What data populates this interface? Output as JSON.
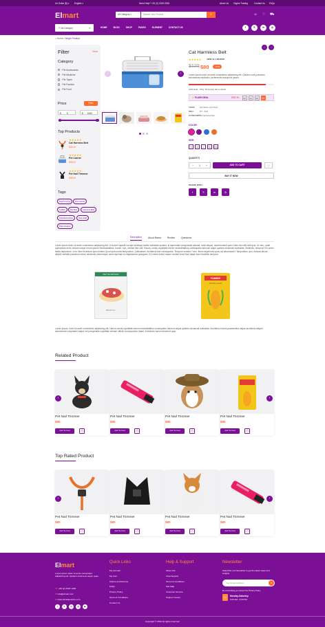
{
  "topbar": {
    "currency": "Us Dollar ($)",
    "language": "English",
    "help": "Need Help? +00 (2) 1525 2255",
    "links": [
      "About Us",
      "Orgine Trading",
      "Contact Us",
      "FAQs"
    ]
  },
  "header": {
    "logo_main": "El",
    "logo_accent": "mart",
    "category_select": "All Category",
    "search_placeholder": "Search Your Product",
    "all_category": "All Category",
    "nav": [
      "HOME",
      "BLOG",
      "SHOP",
      "PAGES",
      "ELEMENT",
      "CONTACT US"
    ],
    "socials": [
      "f",
      "𝕏",
      "in",
      "◎"
    ]
  },
  "breadcrumb": {
    "home": "Home",
    "sep": "/",
    "current": "Single Product"
  },
  "sidebar": {
    "filter_title": "Filter",
    "clear": "Clear",
    "category_title": "Category",
    "categories": [
      "Pet Accessories",
      "Pet Medicine",
      "Pet Toyes",
      "Pet Fashion",
      "Pet Food"
    ],
    "price_title": "Price",
    "filter_btn": "Filter",
    "price_min_currency": "$",
    "price_min": "5",
    "price_max_currency": "$",
    "price_max": "1000",
    "price_range": [
      0.05,
      1.0
    ],
    "top_products_title": "Top Products",
    "top_products": [
      {
        "name": "Cat Harness Belt",
        "price": "$35.00",
        "stars": "★★★★★"
      },
      {
        "name": "Pet Carrier",
        "price": "$35.00",
        "stars": "★★★★★"
      },
      {
        "name": "Pet Nail Trimmer",
        "price": "$35.00",
        "stars": "★★★★★"
      }
    ],
    "tags_title": "Tags",
    "tags": [
      "Nail Trimmer",
      "Pet Carrier",
      "Collars",
      "Pet Bed",
      "Harness Belt",
      "Checked cotton",
      "Sac scarf",
      "Paw Cleaner"
    ]
  },
  "product": {
    "title": "Cat Harmless Belt",
    "stars": "★★★★★",
    "reviews": "VIEW ALL REVIEW",
    "old_price": "$120",
    "price": "$80",
    "discount": "-10%",
    "description": "Lorem ipsum dolor sit amet consectetur adipisicing elit. Quidem sunt possimus accusamus explicabo, perferendis suscipit et ipsam.",
    "stock_text": "10% Sold - Only 15 Item(s) left in stock!",
    "stock_progress": 0.9,
    "flash_label": "⚡ FLASH DEAL",
    "countdown_label": "END IN:",
    "countdown": [
      "05",
      "02",
      "08",
      "55"
    ],
    "tags_label": "TAGS:",
    "tags_value": "pet dress, pet shop",
    "sku_label": "SKU:",
    "sku_value": "PT - 123",
    "category_label": "CATEGORY:",
    "category_value": "Pet accessories",
    "color_label": "COLOR:",
    "colors": [
      "#e91e8c",
      "#7b0f95",
      "#2f6fd6",
      "#e8702a"
    ],
    "size_label": "SIZE:",
    "sizes": [
      "S",
      "M",
      "L",
      "XL",
      "XXL"
    ],
    "quantity_label": "QUANTITY",
    "quantity": "1",
    "add_to_cart": "ADD TO CART",
    "buy_now": "BUY IT NOW",
    "share_label": "SHARE WITH:",
    "share": [
      "f",
      "𝕏",
      "in",
      "◎"
    ]
  },
  "tabs": [
    "Description",
    "About Brand",
    "Review",
    "Questions"
  ],
  "description": {
    "para1": "Lorem ipsum dolor sit amet consectetur adipisicing elit. Ut dolore impedit corrupti similique facilis molestiae quidem, id aspernatur perspiciatis placeat, modi aliquid, reprehenderit porro iusto nisi velit velit quis. Ut vero, amet quibusdam enim veniam neque rerum ipsum! Necessitatibus, harum, iure, veniam iste odit. Harum, omnis cupiditate earum necessitatibus consequatur laborum atque quidem obcaecati molestiae. Distinctio, tempore? Ex animi facilis asperiores, cum, illum inventore quis dolores Quod quia omnis temporibus. Quibusdam. Architecto iste consequatur. Tempore veniam? Vero, libero asperiores quos vel laboriosam? Temporibus, quo, dolores labore aliquid veritatis possimus minus reiciendis doloremque nemo aperiam ex dignissimos quisquam. Ex omnis dolore saepe veniam error illum atque eius blanditiis tempora.",
    "para2": "Lorem ipsum, dolor sit amet consectetur adipisicing elit. Harum omnis cupiditate earum necessitatibus consequatur laborum atque quidem obcaecati molestiae. Architecto harum praesentium atque architecto aliquid assumenda voluptatem eaque vel perspiciatis cupiditate veniam officiis consequuntur totam, Architecto harum deserunt quia.",
    "img1_brand": "PET NUTRITION",
    "img1_sub": "Elmart Co.",
    "img2_brand": "YUMMY",
    "img2_sub": "Pet Dry Food"
  },
  "related": {
    "title": "Related Product",
    "items": [
      {
        "name": "Pet Nail Trimmer",
        "price": "$80",
        "add": "Add To Cart"
      },
      {
        "name": "Pet Nail Trimmer",
        "price": "$80",
        "add": "Add To Cart"
      },
      {
        "name": "Pet Nail Trimmer",
        "price": "$80",
        "add": "Add To Cart"
      },
      {
        "name": "Pet Nail Trimmer",
        "price": "$80",
        "add": "Add To Cart"
      }
    ]
  },
  "top_rated": {
    "title": "Top Rated Product",
    "items": [
      {
        "name": "Pet Nail Trimmer",
        "price": "$80",
        "add": "Add To Cart"
      },
      {
        "name": "Pet Nail Trimmer",
        "price": "$80",
        "add": "Add To Cart"
      },
      {
        "name": "Pet Nail Trimmer",
        "price": "$80",
        "add": "Add To Cart"
      },
      {
        "name": "Pet Nail Trimmer",
        "price": "$80",
        "add": "Add To Cart"
      }
    ]
  },
  "footer": {
    "logo_main": "El",
    "logo_accent": "mart",
    "about": "Lorem ipsum dolor sit amet consectetur adipisicing elit. Quidem minima at sequi, quas.",
    "phone": "+00 (2) 1520 1236",
    "email": "info@elmart.com",
    "website": "www.elmartpetcare.com",
    "socials": [
      "f",
      "𝕏",
      "in",
      "◎",
      "▶"
    ],
    "quick_title": "Quick Links",
    "quick_links": [
      "My Account",
      "My Cart",
      "Orders and Returns",
      "FAQs",
      "Privacy Policy",
      "Terms & Conditions",
      "Contact Us"
    ],
    "help_title": "Help & Support",
    "help_links": [
      "Store Info",
      "Chat Support",
      "Terms & Conditions",
      "Site Map",
      "Customer Service",
      "Support Center"
    ],
    "news_title": "Newsletter",
    "news_text": "Subscribe our Newsletter to get the latest news and insights",
    "news_placeholder": "Your Email Address",
    "news_note": "By subscribing you accept the Privacy Policy",
    "hours_title": "Monday-Saturday",
    "hours": "9.00 AM - 9.00 PM",
    "copyright": "Copyright © 2024 All rights reserved."
  }
}
